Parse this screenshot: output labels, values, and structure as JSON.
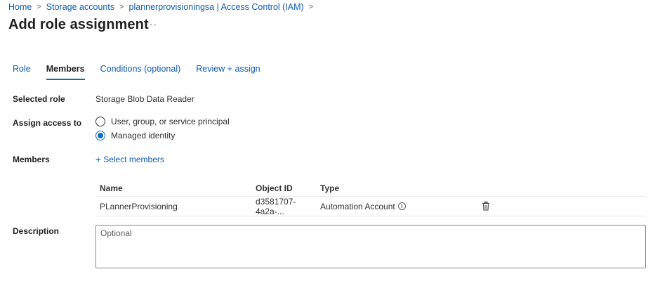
{
  "breadcrumb": {
    "items": [
      "Home",
      "Storage accounts",
      "plannerprovisioningsa | Access Control (IAM)"
    ]
  },
  "page": {
    "title": "Add role assignment",
    "more": "···"
  },
  "tabs": [
    {
      "label": "Role"
    },
    {
      "label": "Members"
    },
    {
      "label": "Conditions (optional)"
    },
    {
      "label": "Review + assign"
    }
  ],
  "form": {
    "selected_role_label": "Selected role",
    "selected_role_value": "Storage Blob Data Reader",
    "assign_access_label": "Assign access to",
    "options": [
      {
        "label": "User, group, or service principal"
      },
      {
        "label": "Managed identity"
      }
    ],
    "members_label": "Members",
    "select_members": "Select members",
    "description_label": "Description",
    "description_placeholder": "Optional"
  },
  "members_table": {
    "headers": {
      "name": "Name",
      "object_id": "Object ID",
      "type": "Type"
    },
    "rows": [
      {
        "name": "PLannerProvisioning",
        "object_id": "d3581707-4a2a-...",
        "type": "Automation Account"
      }
    ]
  },
  "colors": {
    "link": "#0f5db3",
    "accent": "#0f6cbd",
    "border": "#8a8886"
  },
  "icons": {
    "breadcrumb_separator": "chevron-right-icon",
    "more": "more-icon",
    "add": "plus-icon",
    "info": "info-icon",
    "delete": "trash-icon"
  }
}
